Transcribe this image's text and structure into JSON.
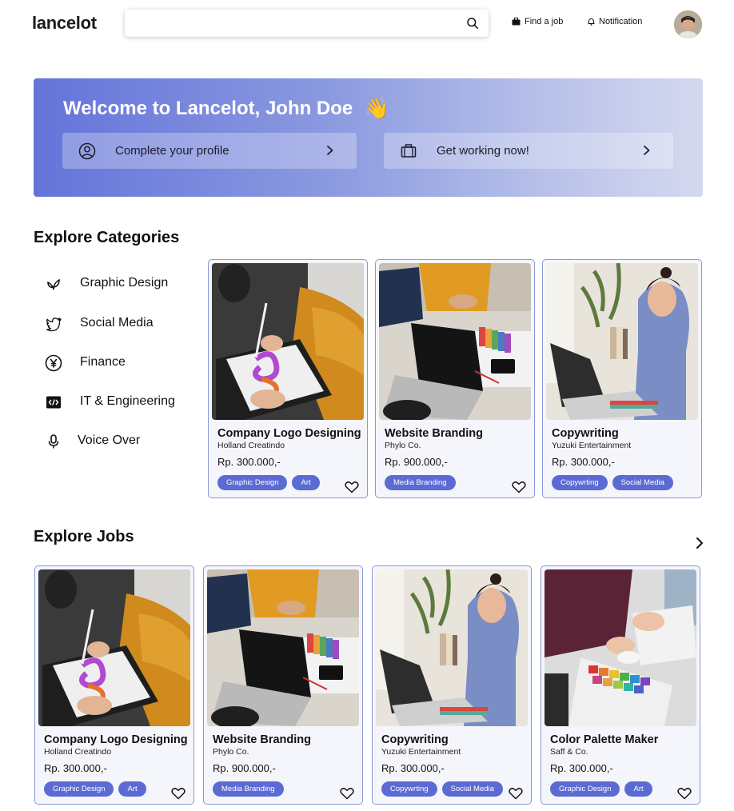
{
  "header": {
    "logo": "lancelot",
    "search_placeholder": "",
    "find_job": "Find a job",
    "notification": "Notification"
  },
  "banner": {
    "title": "Welcome to Lancelot, John Doe",
    "wave": "👋",
    "card1": "Complete your profile",
    "card2": "Get working now!"
  },
  "categories": {
    "title": "Explore Categories",
    "items": [
      {
        "label": "Graphic Design",
        "icon": "leaf-icon"
      },
      {
        "label": "Social Media",
        "icon": "twitter-icon"
      },
      {
        "label": "Finance",
        "icon": "yen-icon"
      },
      {
        "label": "IT & Engineering",
        "icon": "code-icon"
      },
      {
        "label": "Voice Over",
        "icon": "microphone-icon"
      }
    ],
    "cards": [
      {
        "title": "Company Logo Designing",
        "company": "Holland Creatindo",
        "price": "Rp. 300.000,-",
        "tags": [
          "Graphic Design",
          "Art"
        ]
      },
      {
        "title": "Website Branding",
        "company": "Phylo Co.",
        "price": "Rp. 900.000,-",
        "tags": [
          "Media Branding"
        ]
      },
      {
        "title": "Copywriting",
        "company": "Yuzuki Entertainment",
        "price": "Rp. 300.000,-",
        "tags": [
          "Copywrting",
          "Social Media"
        ]
      }
    ]
  },
  "jobs": {
    "title": "Explore Jobs",
    "cards": [
      {
        "title": "Company Logo Designing",
        "company": "Holland Creatindo",
        "price": "Rp. 300.000,-",
        "tags": [
          "Graphic Design",
          "Art"
        ]
      },
      {
        "title": "Website Branding",
        "company": "Phylo Co.",
        "price": "Rp. 900.000,-",
        "tags": [
          "Media Branding"
        ]
      },
      {
        "title": "Copywriting",
        "company": "Yuzuki Entertainment",
        "price": "Rp. 300.000,-",
        "tags": [
          "Copywrting",
          "Social Media"
        ]
      },
      {
        "title": "Color Palette Maker",
        "company": "Saff & Co.",
        "price": "Rp. 300.000,-",
        "tags": [
          "Graphic Design",
          "Art"
        ]
      }
    ]
  },
  "colors": {
    "accent": "#5b6bd3",
    "card_border": "#8a96d6",
    "card_bg": "#f5f6fb"
  }
}
